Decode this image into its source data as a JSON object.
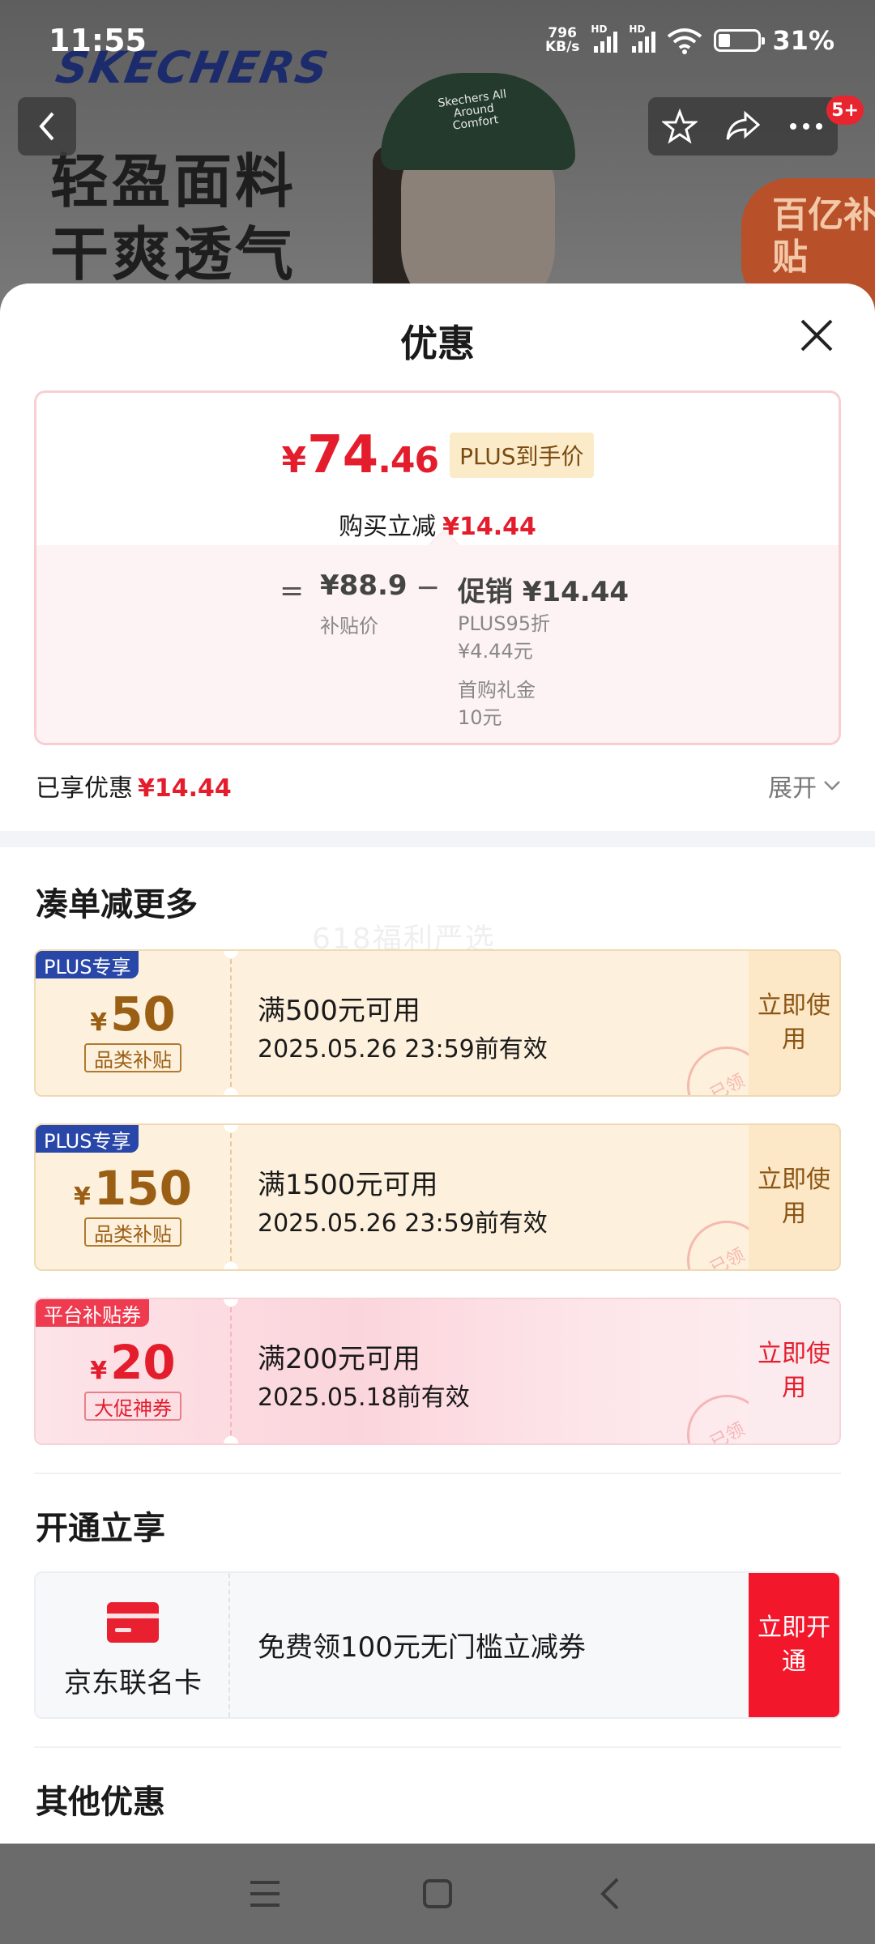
{
  "status_bar": {
    "time": "11:55",
    "net_speed_value": "796",
    "net_speed_unit": "KB/s",
    "hd": "HD",
    "battery": "31%"
  },
  "hero": {
    "brand": "SKECHERS",
    "slogan_line1": "轻盈面料",
    "slogan_line2": "干爽透气",
    "cap_text": "Skechers All Around Comfort",
    "cart_badge": "5+",
    "subsidy_tag": "百亿补贴"
  },
  "sheet": {
    "title": "优惠"
  },
  "price_summary": {
    "currency": "¥",
    "final_int": "74",
    "final_dec": ".46",
    "plus_label": "PLUS到手价",
    "instant_label": "购买立减",
    "instant_value": "¥14.44",
    "eq": "=",
    "base_price": "¥88.9",
    "base_label": "补贴价",
    "minus": "−",
    "promo": "促销 ¥14.44",
    "details": [
      "PLUS95折",
      "¥4.44元",
      "首购礼金",
      "10元"
    ]
  },
  "enjoyed": {
    "label": "已享优惠",
    "value": "¥14.44",
    "expand": "展开"
  },
  "coupon_section": {
    "title": "凑单减更多",
    "watermark": "618福利严选",
    "coupons": [
      {
        "tag": "PLUS专享",
        "currency": "¥",
        "amount": "50",
        "type": "品类补贴",
        "condition": "满500元可用",
        "validity": "2025.05.26 23:59前有效",
        "action": "立即使用",
        "stamp": "已领"
      },
      {
        "tag": "PLUS专享",
        "currency": "¥",
        "amount": "150",
        "type": "品类补贴",
        "condition": "满1500元可用",
        "validity": "2025.05.26 23:59前有效",
        "action": "立即使用",
        "stamp": "已领"
      },
      {
        "tag": "平台补贴券",
        "currency": "¥",
        "amount": "20",
        "type": "大促神券",
        "condition": "满200元可用",
        "validity": "2025.05.18前有效",
        "action": "立即使用",
        "stamp": "已领"
      }
    ]
  },
  "open_section": {
    "title": "开通立享",
    "card_name": "京东联名卡",
    "description": "免费领100元无门槛立减券",
    "action": "立即开通"
  },
  "other_section": {
    "title": "其他优惠"
  },
  "colors": {
    "price_red": "#e41d2d",
    "plus_blue": "#2847a8",
    "gold_text": "#9a5f14",
    "open_red": "#f3172b"
  }
}
